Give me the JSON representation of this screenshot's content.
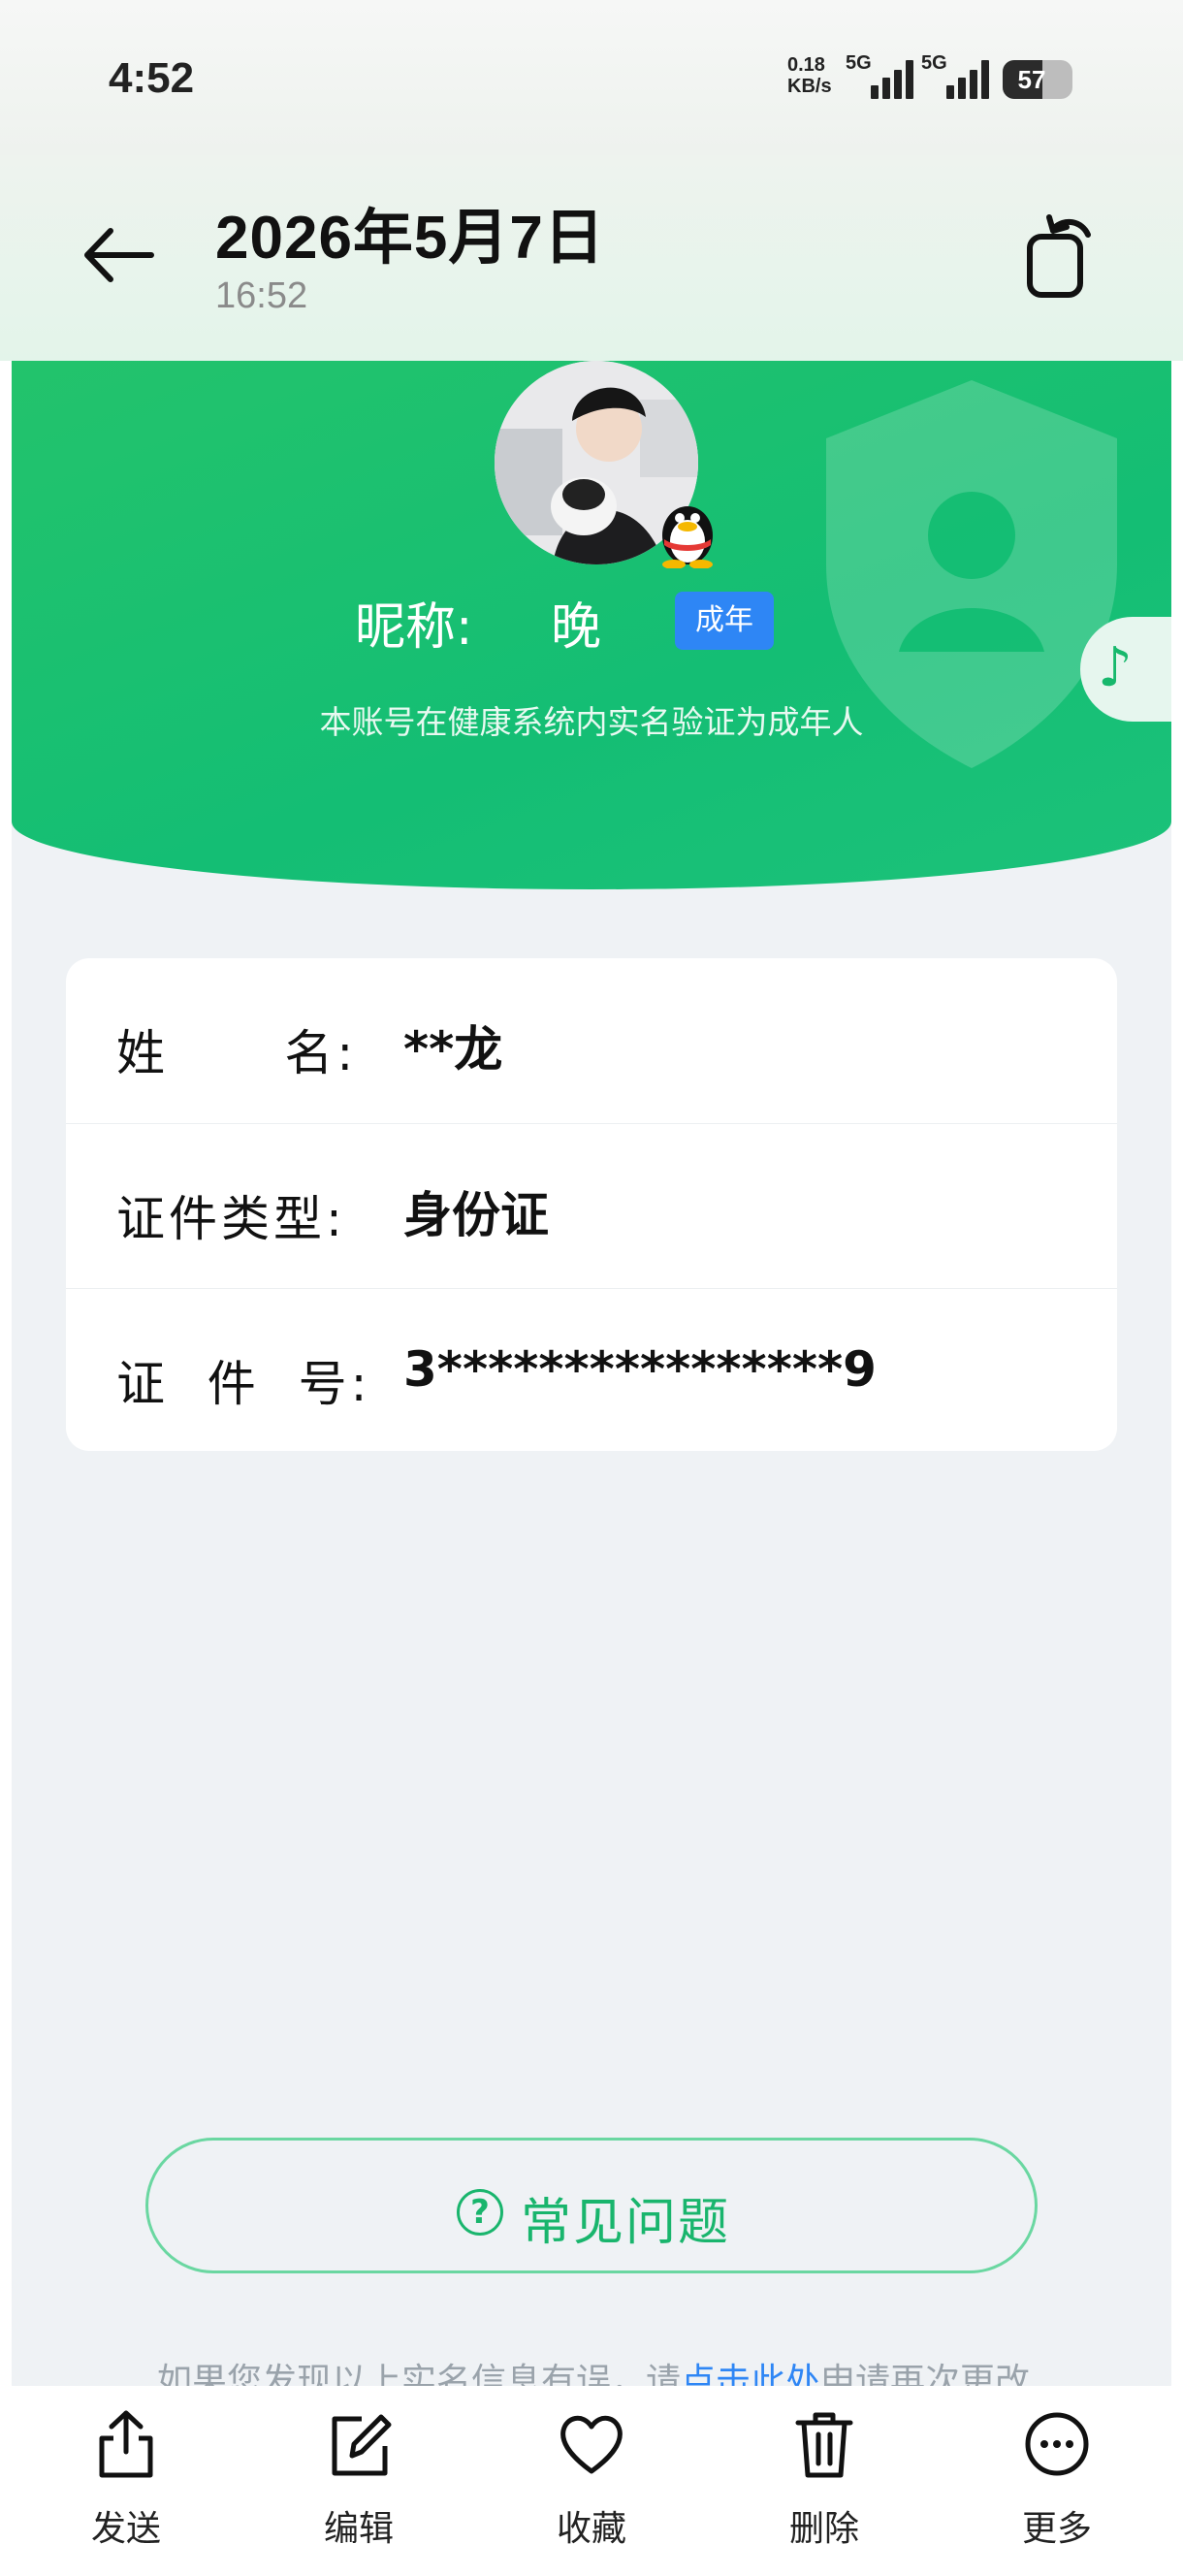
{
  "status_bar": {
    "time": "4:52",
    "net_speed_value": "0.18",
    "net_speed_unit": "KB/s",
    "sim1_label": "5G",
    "sim2_label": "5G",
    "battery_percent": "57"
  },
  "header": {
    "title": "2026年5月7日",
    "subtitle": "16:52"
  },
  "profile": {
    "nickname_label": "昵称:",
    "nickname_value": "晚",
    "adult_badge": "成年",
    "description": "本账号在健康系统内实名验证为成年人"
  },
  "info": {
    "rows": [
      {
        "label": "姓      名:",
        "value": "**龙"
      },
      {
        "label": "证件类型:",
        "value": "身份证"
      },
      {
        "label": "证  件  号:",
        "value": "3****************9"
      }
    ]
  },
  "faq": {
    "icon": "?",
    "label": "常见问题"
  },
  "notice": {
    "prefix": "如果您发现以上实名信息有误，请",
    "link": "点击此处",
    "suffix": "申请再次更改"
  },
  "toolbar": {
    "items": [
      {
        "label": "发送",
        "icon": "share-icon"
      },
      {
        "label": "编辑",
        "icon": "edit-icon"
      },
      {
        "label": "收藏",
        "icon": "heart-icon"
      },
      {
        "label": "删除",
        "icon": "trash-icon"
      },
      {
        "label": "更多",
        "icon": "more-icon"
      }
    ]
  },
  "colors": {
    "brand_green": "#1cc174",
    "badge_blue": "#2e86f5",
    "link_blue": "#2e86f5"
  }
}
